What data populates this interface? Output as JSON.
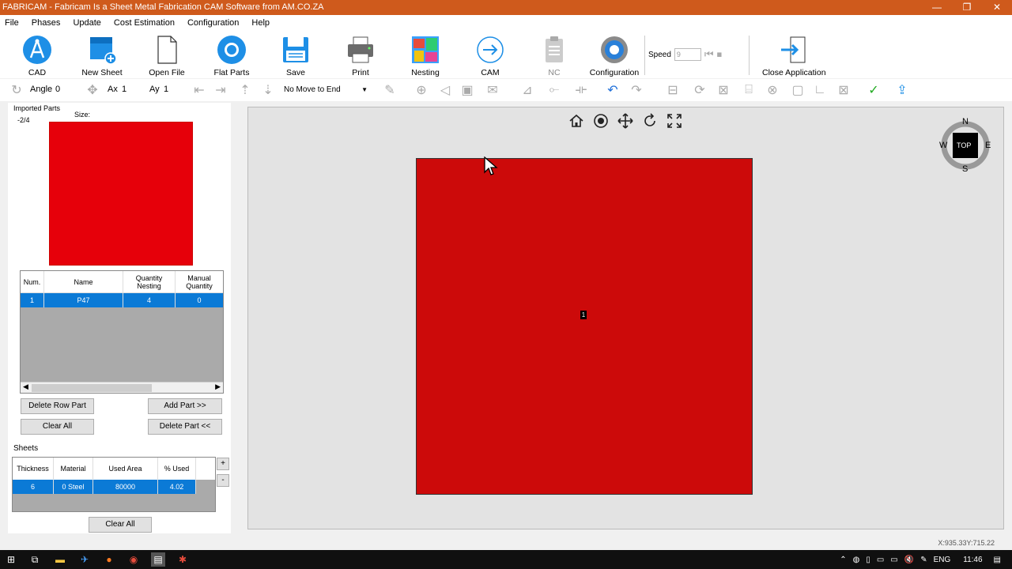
{
  "window": {
    "title": "FABRICAM - Fabricam Is a Sheet Metal Fabrication CAM Software from AM.CO.ZA",
    "minimize": "—",
    "maximize": "❐",
    "close": "✕"
  },
  "menu": [
    "File",
    "Phases",
    "Update",
    "Cost Estimation",
    "Configuration",
    "Help"
  ],
  "toolbar": {
    "cad": "CAD",
    "new_sheet": "New Sheet",
    "open_file": "Open File",
    "flat_parts": "Flat Parts",
    "save": "Save",
    "print": "Print",
    "nesting": "Nesting",
    "cam": "CAM",
    "nc": "NC",
    "configuration": "Configuration",
    "speed_label": "Speed",
    "speed_value": "9",
    "close_application": "Close Application"
  },
  "toolbar2": {
    "angle_label": "Angle",
    "angle_value": "0",
    "ax_label": "Ax",
    "ax_value": "1",
    "ay_label": "Ay",
    "ay_value": "1",
    "move_option": "No Move to End"
  },
  "left_panel": {
    "imported_parts_label": "Imported Parts",
    "counter": "-2/4",
    "size_label": "Size:",
    "parts_table": {
      "headers": [
        "Num.",
        "Name",
        "Quantity Nesting",
        "Manual Quantity"
      ],
      "rows": [
        [
          "1",
          "P47",
          "4",
          "0"
        ]
      ]
    },
    "delete_row_part": "Delete Row Part",
    "add_part": "Add Part >>",
    "clear_all": "Clear All",
    "delete_part": "Delete Part <<",
    "sheets_label": "Sheets",
    "sheets_table": {
      "headers": [
        "Thickness",
        "Material",
        "Used Area",
        "% Used"
      ],
      "rows": [
        [
          "6",
          "0  Steel",
          "80000",
          "4.02"
        ]
      ]
    },
    "plus": "+",
    "minus": "-",
    "clear_all_sheets": "Clear All"
  },
  "canvas": {
    "part_label": "1",
    "compass": {
      "n": "N",
      "s": "S",
      "e": "E",
      "w": "W",
      "face": "TOP"
    }
  },
  "status": {
    "coords": "X:935.33Y:715.22"
  },
  "taskbar": {
    "lang": "ENG",
    "time": "11:46"
  },
  "colors": {
    "title_bar": "#cf5a1c",
    "selection": "#0b7ad6",
    "part_red": "#e6000a",
    "sheet_red": "#cc0a0a"
  }
}
